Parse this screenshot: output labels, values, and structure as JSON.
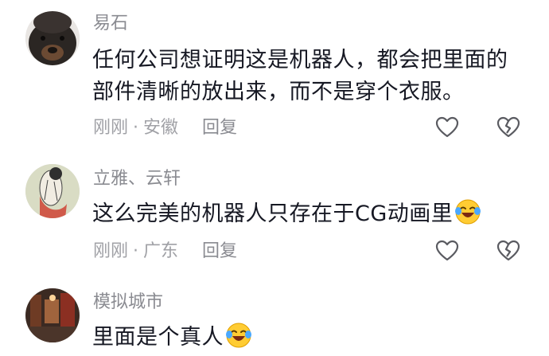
{
  "comments": [
    {
      "username": "易石",
      "text": "任何公司想证明这是机器人，都会把里面的部件清晰的放出来，而不是穿个衣服。",
      "time": "刚刚",
      "location": "安徽",
      "reply_label": "回复",
      "emoji": ""
    },
    {
      "username": "立雅、云轩",
      "text": "这么完美的机器人只存在于CG动画里",
      "time": "刚刚",
      "location": "广东",
      "reply_label": "回复",
      "emoji": "laughing-crying-emoji"
    },
    {
      "username": "模拟城市",
      "text": "里面是个真人",
      "emoji": "laughing-crying-emoji"
    }
  ],
  "icons": {
    "like": "heart-outline-icon",
    "dislike": "broken-heart-icon"
  },
  "colors": {
    "username": "#8a8b91",
    "text": "#161823",
    "meta": "#a0a1a6"
  },
  "separator": "·"
}
